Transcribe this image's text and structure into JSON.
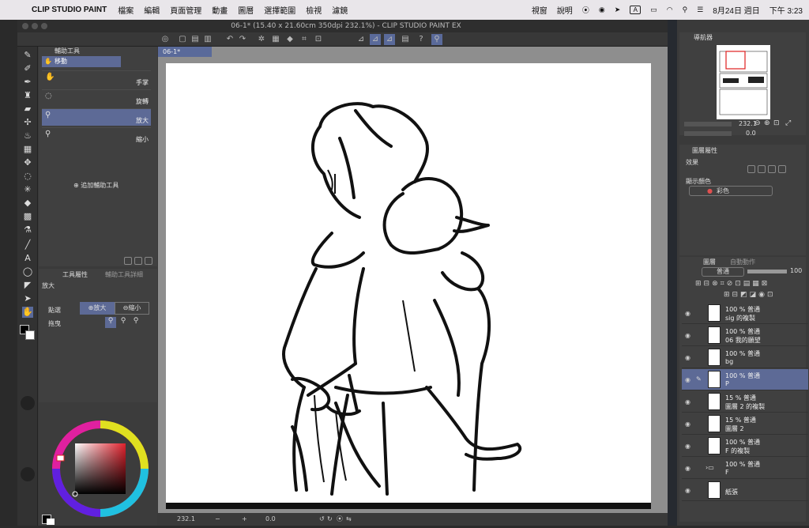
{
  "menubar": {
    "app_name": "CLIP STUDIO PAINT",
    "items": [
      "檔案",
      "編輯",
      "頁面管理",
      "動畫",
      "圖層",
      "選擇範圍",
      "檢視",
      "濾鏡"
    ],
    "right_items": [
      "視窗",
      "說明"
    ],
    "input_method": "A",
    "date": "8月24日 週日",
    "time": "下午 3:23"
  },
  "window": {
    "title": "06-1* (15.40 x 21.60cm 350dpi 232.1%) - CLIP STUDIO PAINT EX",
    "doc_tab": "06-1*"
  },
  "subtool": {
    "tab_label": "輔助工具",
    "group_name": "移動",
    "items": [
      {
        "label": "手掌",
        "icon": "hand-icon"
      },
      {
        "label": "旋轉",
        "icon": "rotate-icon"
      },
      {
        "label": "放大",
        "icon": "zoom-in-icon"
      },
      {
        "label": "縮小",
        "icon": "zoom-out-icon"
      }
    ],
    "add_label": "追加輔助工具"
  },
  "toolprop": {
    "tab_label": "工具屬性",
    "tab2_label": "輔助工具詳細",
    "title": "放大",
    "click_label": "點選",
    "zoom_in": "放大",
    "zoom_out": "縮小",
    "drag_label": "拖曳"
  },
  "status": {
    "zoom": "232.1",
    "angle": "0.0"
  },
  "navigator": {
    "tab_label": "導航器",
    "zoom": "232.1",
    "angle": "0.0"
  },
  "layer_prop": {
    "tab_label": "圖層屬性",
    "effect_label": "效果",
    "display_color_label": "顯示顏色",
    "color_mode": "彩色"
  },
  "layers_panel": {
    "tab_label": "圖層",
    "tab2_label": "自動動作",
    "blend_mode": "普通",
    "opacity": "100",
    "layers": [
      {
        "opacity": "100 %",
        "mode": "普通",
        "name": "sig 的複製",
        "selected": false
      },
      {
        "opacity": "100 %",
        "mode": "普通",
        "name": "06 我的願望",
        "selected": false
      },
      {
        "opacity": "100 %",
        "mode": "普通",
        "name": "bg",
        "selected": false
      },
      {
        "opacity": "100 %",
        "mode": "普通",
        "name": "P",
        "selected": true
      },
      {
        "opacity": "15 %",
        "mode": "普通",
        "name": "圖層 2 的複製",
        "selected": false
      },
      {
        "opacity": "15 %",
        "mode": "普通",
        "name": "圖層 2",
        "selected": false
      },
      {
        "opacity": "100 %",
        "mode": "普通",
        "name": "F 的複製",
        "selected": false
      },
      {
        "opacity": "100 %",
        "mode": "普通",
        "name": "F",
        "selected": false
      },
      {
        "opacity": "",
        "mode": "",
        "name": "紙張",
        "selected": false
      }
    ]
  },
  "colors": {
    "accent": "#5d6a96",
    "main_color": "#000000",
    "sub_color": "#ffffff"
  }
}
